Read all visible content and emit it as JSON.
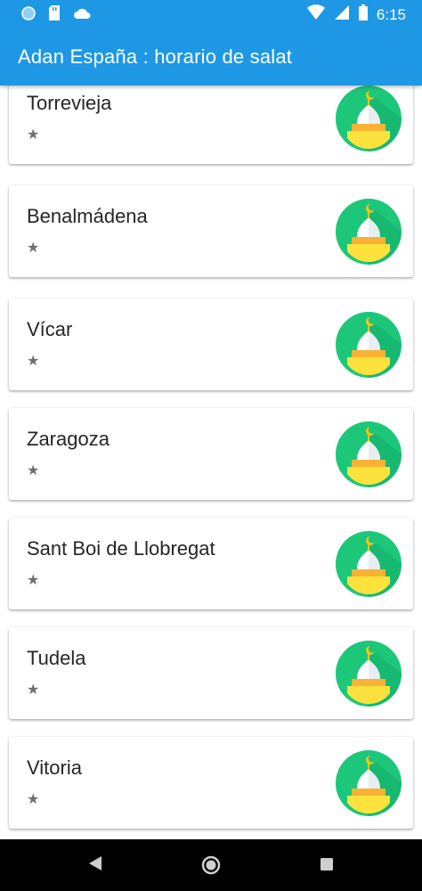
{
  "status_bar": {
    "time": "6:15",
    "icons_left": [
      "circle-notification-icon",
      "sd-card-icon",
      "cloud-icon"
    ],
    "icons_right": [
      "wifi-icon",
      "signal-icon",
      "battery-icon"
    ]
  },
  "app_bar": {
    "title": "Adan España : horario de salat"
  },
  "cities": [
    {
      "name": "Torrevieja",
      "star": "★",
      "icon": "mosque-icon"
    },
    {
      "name": "Benalmádena",
      "star": "★",
      "icon": "mosque-icon"
    },
    {
      "name": "Vícar",
      "star": "★",
      "icon": "mosque-icon"
    },
    {
      "name": "Zaragoza",
      "star": "★",
      "icon": "mosque-icon"
    },
    {
      "name": "Sant Boi de Llobregat",
      "star": "★",
      "icon": "mosque-icon"
    },
    {
      "name": "Tudela",
      "star": "★",
      "icon": "mosque-icon"
    },
    {
      "name": "Vitoria",
      "star": "★",
      "icon": "mosque-icon"
    }
  ],
  "nav_bar": {
    "buttons": [
      "back-icon",
      "home-icon",
      "recents-icon"
    ]
  },
  "colors": {
    "primary": "#1E98E5",
    "icon_green": "#1CC77A",
    "icon_yellow": "#FDE23E",
    "icon_orange": "#F9B233",
    "icon_moon": "#F5C518"
  }
}
